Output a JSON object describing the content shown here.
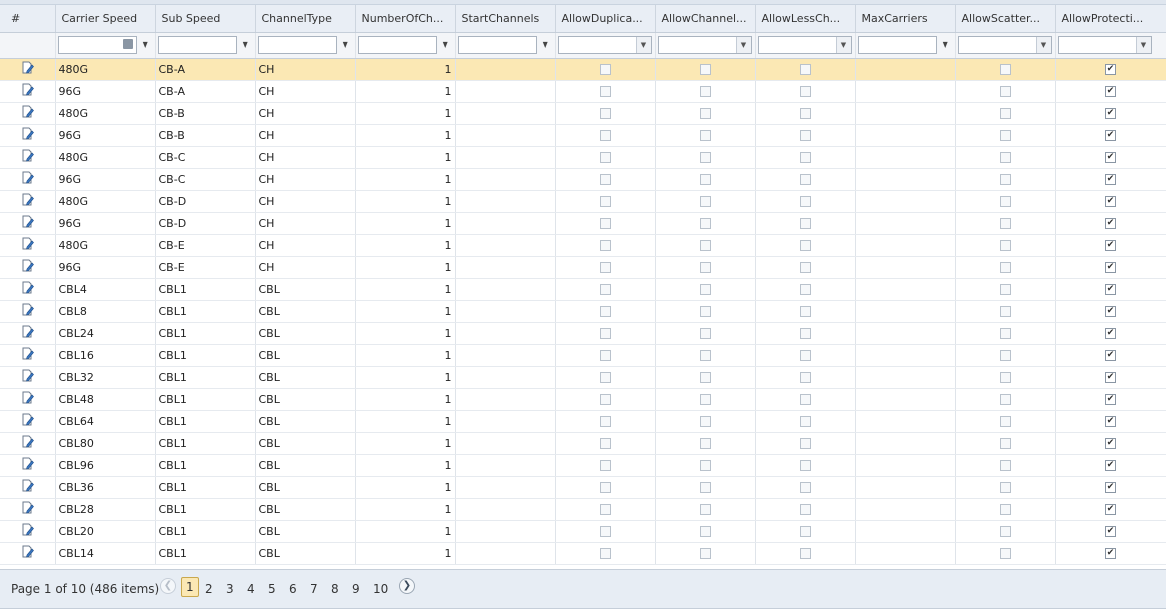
{
  "columns": [
    "#",
    "Carrier Speed",
    "Sub Speed",
    "ChannelType",
    "NumberOfCh...",
    "StartChannels",
    "AllowDuplica...",
    "AllowChannel...",
    "AllowLessCh...",
    "MaxCarriers",
    "AllowScatter...",
    "AllowProtecti..."
  ],
  "rows": [
    {
      "carrier": "480G",
      "sub": "CB-A",
      "type": "CH",
      "num": "1",
      "selected": true
    },
    {
      "carrier": "96G",
      "sub": "CB-A",
      "type": "CH",
      "num": "1"
    },
    {
      "carrier": "480G",
      "sub": "CB-B",
      "type": "CH",
      "num": "1"
    },
    {
      "carrier": "96G",
      "sub": "CB-B",
      "type": "CH",
      "num": "1"
    },
    {
      "carrier": "480G",
      "sub": "CB-C",
      "type": "CH",
      "num": "1"
    },
    {
      "carrier": "96G",
      "sub": "CB-C",
      "type": "CH",
      "num": "1"
    },
    {
      "carrier": "480G",
      "sub": "CB-D",
      "type": "CH",
      "num": "1"
    },
    {
      "carrier": "96G",
      "sub": "CB-D",
      "type": "CH",
      "num": "1"
    },
    {
      "carrier": "480G",
      "sub": "CB-E",
      "type": "CH",
      "num": "1"
    },
    {
      "carrier": "96G",
      "sub": "CB-E",
      "type": "CH",
      "num": "1"
    },
    {
      "carrier": "CBL4",
      "sub": "CBL1",
      "type": "CBL",
      "num": "1"
    },
    {
      "carrier": "CBL8",
      "sub": "CBL1",
      "type": "CBL",
      "num": "1"
    },
    {
      "carrier": "CBL24",
      "sub": "CBL1",
      "type": "CBL",
      "num": "1"
    },
    {
      "carrier": "CBL16",
      "sub": "CBL1",
      "type": "CBL",
      "num": "1"
    },
    {
      "carrier": "CBL32",
      "sub": "CBL1",
      "type": "CBL",
      "num": "1"
    },
    {
      "carrier": "CBL48",
      "sub": "CBL1",
      "type": "CBL",
      "num": "1"
    },
    {
      "carrier": "CBL64",
      "sub": "CBL1",
      "type": "CBL",
      "num": "1"
    },
    {
      "carrier": "CBL80",
      "sub": "CBL1",
      "type": "CBL",
      "num": "1"
    },
    {
      "carrier": "CBL96",
      "sub": "CBL1",
      "type": "CBL",
      "num": "1"
    },
    {
      "carrier": "CBL36",
      "sub": "CBL1",
      "type": "CBL",
      "num": "1"
    },
    {
      "carrier": "CBL28",
      "sub": "CBL1",
      "type": "CBL",
      "num": "1"
    },
    {
      "carrier": "CBL20",
      "sub": "CBL1",
      "type": "CBL",
      "num": "1"
    },
    {
      "carrier": "CBL14",
      "sub": "CBL1",
      "type": "CBL",
      "num": "1"
    }
  ],
  "pager": {
    "info": "Page 1 of 10 (486 items)",
    "pages": [
      "1",
      "2",
      "3",
      "4",
      "5",
      "6",
      "7",
      "8",
      "9",
      "10"
    ],
    "current": "1"
  },
  "colors": {
    "selected_row": "#fbe8b4",
    "header_bg": "#e9eef5",
    "pager_bg": "#e7edf4"
  },
  "icons": {
    "row_edit": "edit-icon",
    "filter": "filter-icon",
    "prev": "prev-page-icon",
    "next": "next-page-icon"
  }
}
